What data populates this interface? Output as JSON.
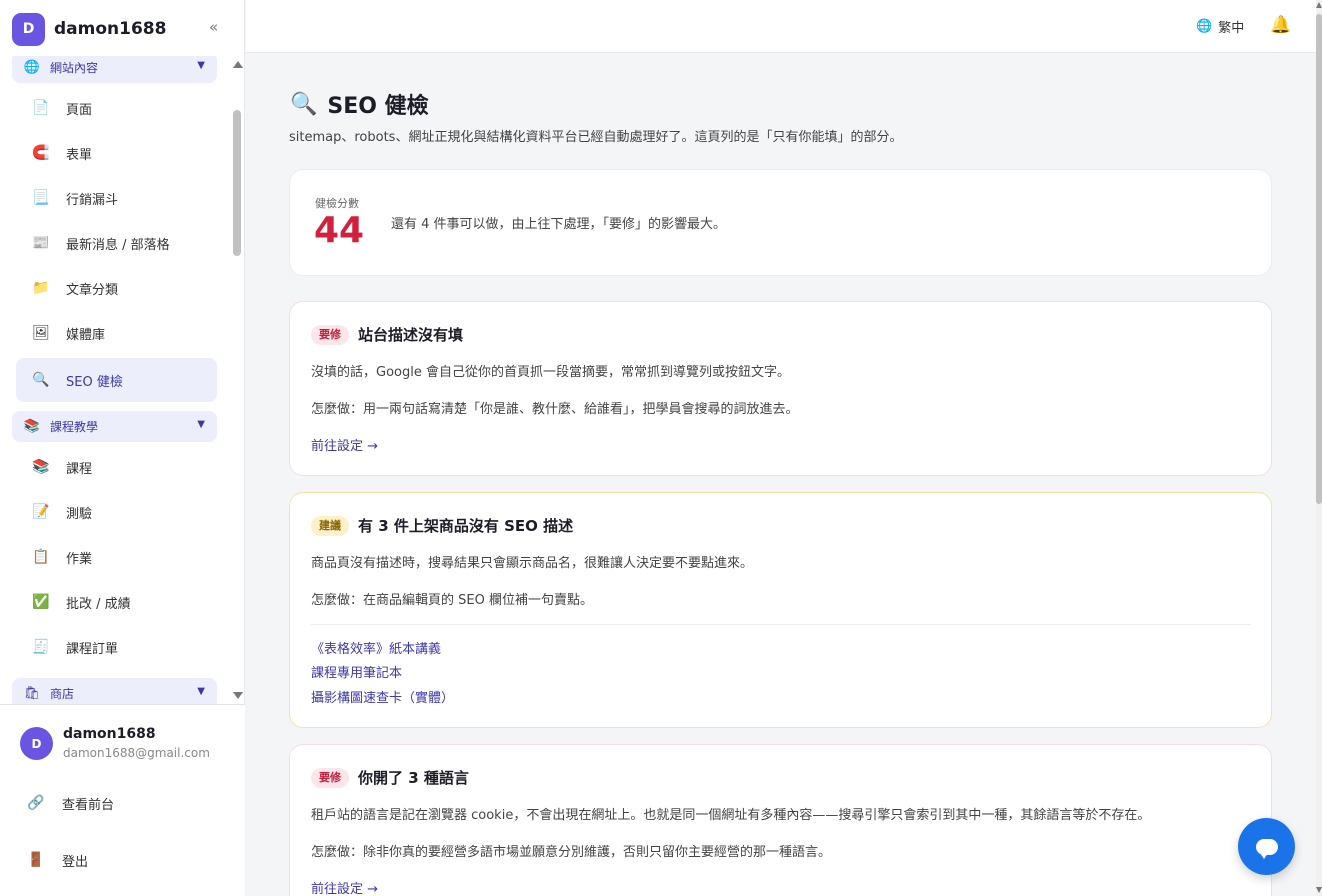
{
  "sidebar": {
    "brand_initial": "D",
    "brand_name": "damon1688",
    "collapse_label": "«",
    "groups": [
      {
        "label": "網站內容",
        "icon": "globe-icon"
      },
      {
        "label": "課程教學",
        "icon": "books-icon"
      },
      {
        "label": "商店",
        "icon": "shopping-bag-icon"
      }
    ],
    "items": [
      {
        "label": "頁面",
        "icon": "page-icon"
      },
      {
        "label": "表單",
        "icon": "magnet-icon"
      },
      {
        "label": "行銷漏斗",
        "icon": "funnel-icon"
      },
      {
        "label": "最新消息 / 部落格",
        "icon": "newspaper-icon"
      },
      {
        "label": "文章分類",
        "icon": "folder-icon"
      },
      {
        "label": "媒體庫",
        "icon": "picture-icon"
      },
      {
        "label": "SEO 健檢",
        "icon": "magnifier-icon",
        "active": true
      },
      {
        "label": "課程",
        "icon": "books-icon"
      },
      {
        "label": "測驗",
        "icon": "pencil-paper-icon"
      },
      {
        "label": "作業",
        "icon": "clipboard-icon"
      },
      {
        "label": "批改 / 成績",
        "icon": "check-box-icon"
      },
      {
        "label": "課程訂單",
        "icon": "receipt-icon"
      }
    ],
    "user": {
      "initial": "D",
      "name": "damon1688",
      "email": "damon1688@gmail.com"
    },
    "view_frontend": "查看前台",
    "logout": "登出"
  },
  "topbar": {
    "language": "繁中"
  },
  "main": {
    "title": "SEO 健檢",
    "description": "sitemap、robots、網址正規化與結構化資料平台已經自動處理好了。這頁列的是「只有你能填」的部分。",
    "score": {
      "label": "健檢分數",
      "value": "44",
      "summary": "還有 4 件事可以做，由上往下處理，「要修」的影響最大。"
    },
    "issues": [
      {
        "badge": "要修",
        "title": "站台描述沒有填",
        "problem": "沒填的話，Google 會自己從你的首頁抓一段當摘要，常常抓到導覽列或按鈕文字。",
        "fix": "怎麼做：用一兩句話寫清楚「你是誰、教什麼、給誰看」，把學員會搜尋的詞放進去。",
        "link": "前往設定 →"
      },
      {
        "badge": "建議",
        "title": "有 3 件上架商品沒有 SEO 描述",
        "problem": "商品頁沒有描述時，搜尋結果只會顯示商品名，很難讓人決定要不要點進來。",
        "fix": "怎麼做：在商品編輯頁的 SEO 欄位補一句賣點。",
        "products": [
          "《表格效率》紙本講義",
          "課程專用筆記本",
          "攝影構圖速查卡（實體）"
        ]
      },
      {
        "badge": "要修",
        "title": "你開了 3 種語言",
        "problem": "租戶站的語言是記在瀏覽器 cookie，不會出現在網址上。也就是同一個網址有多種內容——搜尋引擎只會索引到其中一種，其餘語言等於不存在。",
        "fix": "怎麼做：除非你真的要經營多語市場並願意分別維護，否則只留你主要經營的那一種語言。",
        "link": "前往設定 →"
      }
    ]
  },
  "colors": {
    "accent": "#3c38a9",
    "brand": "#6a55e3",
    "score": "#d0203d",
    "fix_badge_bg": "#fde6ea",
    "suggest_badge_bg": "#fdf1c9",
    "chat_button": "#1a73e8"
  }
}
